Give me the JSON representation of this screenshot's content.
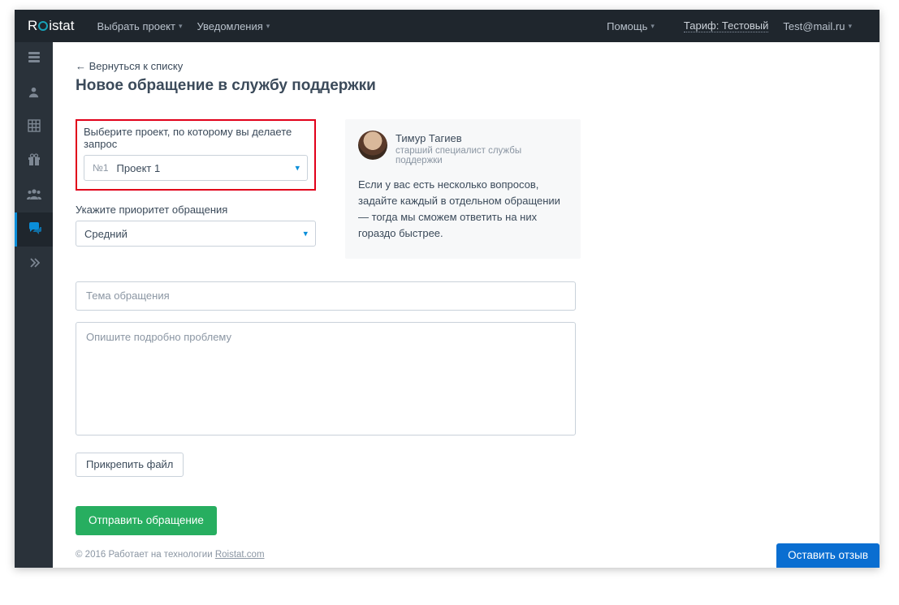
{
  "header": {
    "logo_prefix": "R",
    "logo_suffix": "istat",
    "project_selector": "Выбрать проект",
    "notifications": "Уведомления",
    "help": "Помощь",
    "tariff": "Тариф: Тестовый",
    "user_email": "Test@mail.ru"
  },
  "sidebar": {
    "icons": [
      "server",
      "user",
      "grid",
      "gift",
      "users",
      "chat",
      "expand"
    ]
  },
  "page": {
    "back_link": "← Вернуться к списку",
    "title": "Новое обращение в службу поддержки"
  },
  "form": {
    "project_label": "Выберите проект, по которому вы делаете запрос",
    "project_num": "№1",
    "project_value": "Проект 1",
    "priority_label": "Укажите приоритет обращения",
    "priority_value": "Средний",
    "subject_placeholder": "Тема обращения",
    "description_placeholder": "Опишите подробно проблему",
    "attach_label": "Прикрепить файл",
    "submit_label": "Отправить обращение"
  },
  "specialist": {
    "name": "Тимур Тагиев",
    "role": "старший специалист службы поддержки",
    "hint": "Если у вас есть несколько вопросов, задайте каждый в отдельном обращении — тогда мы сможем ответить на них гораздо быстрее."
  },
  "footer": {
    "copyright": "© 2016 Работает на технологии ",
    "link_text": "Roistat.com"
  },
  "feedback_button": "Оставить отзыв"
}
